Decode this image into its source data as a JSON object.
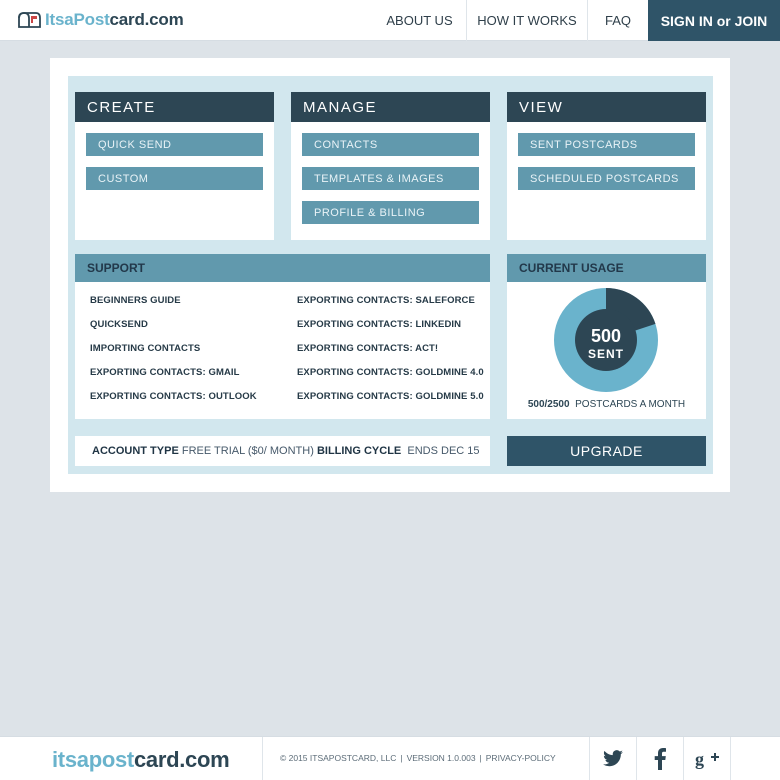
{
  "brand": {
    "name_part1": "ItsaPost",
    "name_part2": "card.com",
    "accent": "#6ab3cc",
    "dark": "#2d4654"
  },
  "nav": {
    "about": "ABOUT US",
    "how": "HOW IT WORKS",
    "faq": "FAQ",
    "signin": "SIGN IN or JOIN"
  },
  "create": {
    "title": "CREATE",
    "items": [
      "QUICK SEND",
      "CUSTOM"
    ]
  },
  "manage": {
    "title": "MANAGE",
    "items": [
      "CONTACTS",
      "TEMPLATES & IMAGES",
      "PROFILE & BILLING"
    ]
  },
  "view": {
    "title": "VIEW",
    "items": [
      "SENT POSTCARDS",
      "SCHEDULED POSTCARDS"
    ]
  },
  "support": {
    "title": "SUPPORT",
    "left": [
      "BEGINNERS GUIDE",
      "QUICKSEND",
      "IMPORTING CONTACTS",
      "EXPORTING CONTACTS: GMAIL",
      "EXPORTING CONTACTS: OUTLOOK"
    ],
    "right": [
      "EXPORTING CONTACTS: SALEFORCE",
      "EXPORTING CONTACTS: LINKEDIN",
      "EXPORTING CONTACTS: ACT!",
      "EXPORTING CONTACTS: GOLDMINE 4.0",
      "EXPORTING CONTACTS: GOLDMINE 5.0"
    ]
  },
  "usage": {
    "title": "CURRENT USAGE",
    "sent_number": "500",
    "sent_label": "SENT",
    "used": 500,
    "limit": 2500,
    "fraction_used": 0.2,
    "summary_count": "500/2500",
    "summary_label": "POSTCARDS A MONTH",
    "color_used": "#2d4654",
    "color_remaining": "#6ab3cc"
  },
  "account": {
    "type_label": "ACCOUNT TYPE",
    "type_value": "FREE TRIAL ($0/ MONTH)",
    "billing_label": "BILLING CYCLE",
    "billing_value": "ENDS DEC 15"
  },
  "upgrade_label": "UPGRADE",
  "footer": {
    "logo_part1": "itsapost",
    "logo_part2": "card.com",
    "copyright": "© 2015 ITSAPOSTCARD, LLC",
    "version": "VERSION 1.0.003",
    "privacy": "PRIVACY-POLICY",
    "separator": "|",
    "social": [
      "twitter-icon",
      "facebook-icon",
      "google-plus-icon"
    ]
  }
}
